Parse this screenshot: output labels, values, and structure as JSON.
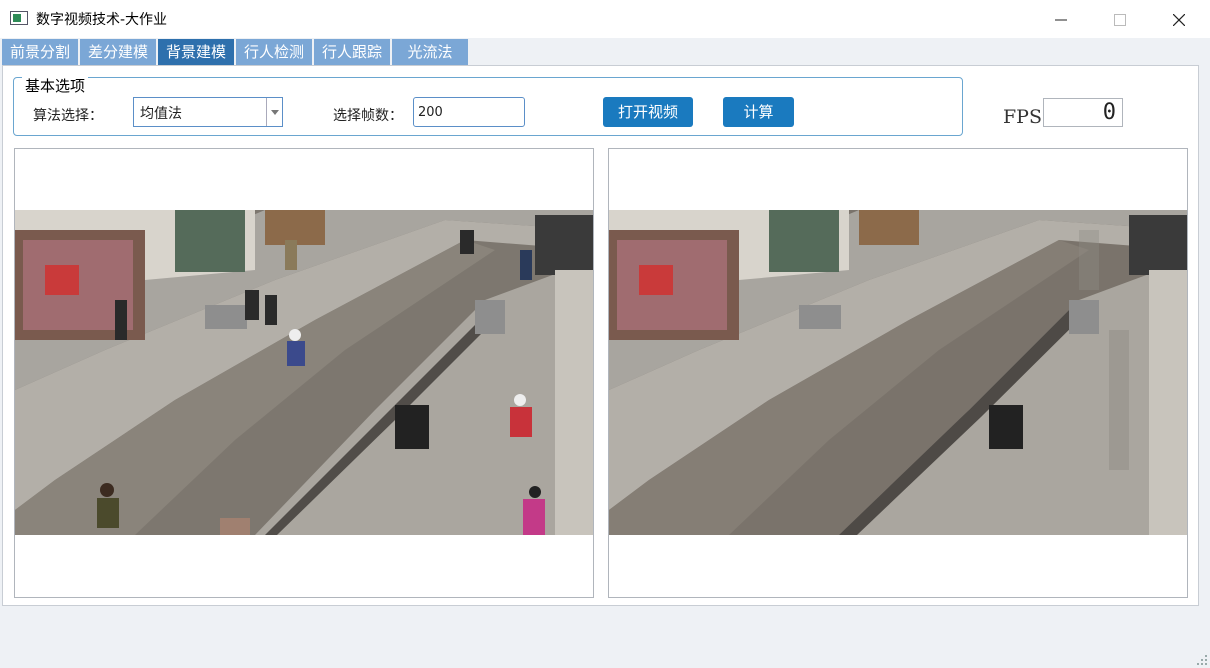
{
  "window": {
    "title": "数字视频技术-大作业",
    "minimize_icon": "minimize-icon",
    "maximize_icon": "maximize-icon",
    "close_icon": "close-icon"
  },
  "tabs": [
    {
      "label": "前景分割",
      "active": false
    },
    {
      "label": "差分建模",
      "active": false
    },
    {
      "label": "背景建模",
      "active": true
    },
    {
      "label": "行人检测",
      "active": false
    },
    {
      "label": "行人跟踪",
      "active": false
    },
    {
      "label": "光流法",
      "active": false
    }
  ],
  "options": {
    "group_title": "基本选项",
    "algorithm_label": "算法选择：",
    "algorithm_value": "均值法",
    "frames_label": "选择帧数：",
    "frames_value": "200",
    "open_video_button": "打开视频",
    "compute_button": "计算"
  },
  "fps": {
    "label": "FPS",
    "value": "0"
  },
  "colors": {
    "tab_active": "#2e70ad",
    "tab_inactive": "#7ba7d6",
    "button": "#1a7abf",
    "accent_border": "#6aa6d0"
  }
}
